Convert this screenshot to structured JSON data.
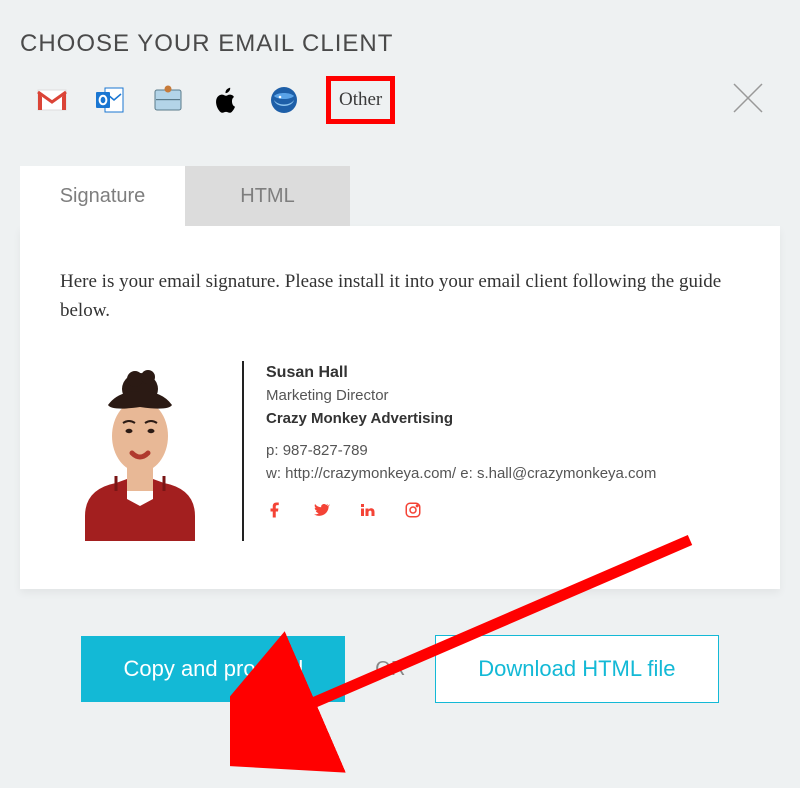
{
  "heading": "CHOOSE YOUR EMAIL CLIENT",
  "clients": {
    "other_label": "Other"
  },
  "tabs": {
    "signature": "Signature",
    "html": "HTML"
  },
  "panel": {
    "intro": "Here is your email signature. Please install it into your email client following the guide below."
  },
  "signature": {
    "name": "Susan Hall",
    "title": "Marketing Director",
    "company": "Crazy Monkey Advertising",
    "phone_label": "p:",
    "phone": "987-827-789",
    "web_label": "w:",
    "web": "http://crazymonkeya.com/",
    "email_label": "e:",
    "email": "s.hall@crazymonkeya.com"
  },
  "actions": {
    "copy": "Copy and proceed",
    "or": "OR",
    "download": "Download HTML file"
  }
}
